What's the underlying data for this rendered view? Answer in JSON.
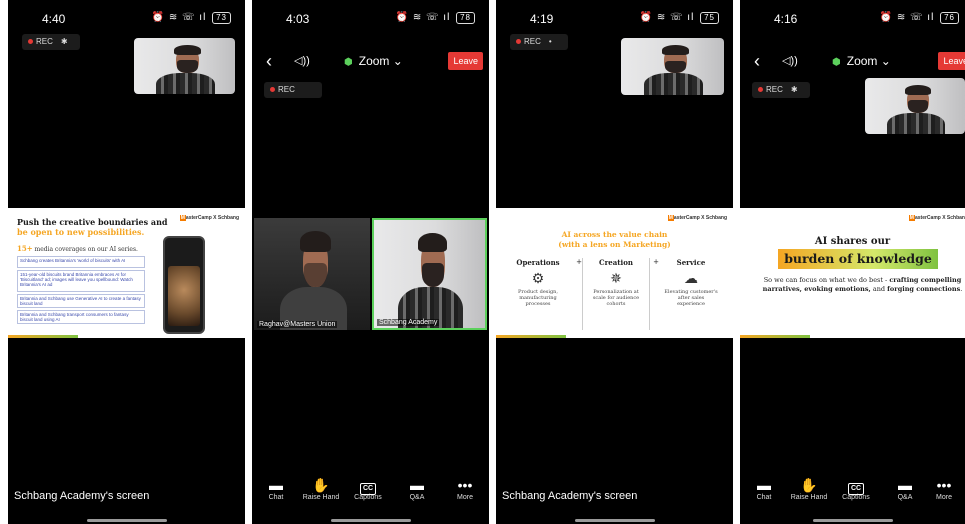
{
  "colors": {
    "leave": "#e53935",
    "rec_dot": "#e53935",
    "zoom_shield": "#5cd05c",
    "accent_orange": "#f5a623",
    "accent_green": "#7fc241"
  },
  "phones": [
    {
      "status": {
        "time": "4:40",
        "battery": "73"
      },
      "rec": {
        "label": "REC",
        "extra": "✱"
      },
      "screen_label": "Schbang Academy's screen",
      "slide": {
        "title1": "Push the creative boundaries and",
        "title2": "be open to new possibilities.",
        "coverage_count": "15+",
        "coverage_text": "media coverages on our AI series.",
        "items": [
          "Schbang creates Britannia's 'world of biscuits' with AI",
          "151-year-old biscuits brand Britannia embraces AI for 'Biscuitland' ad; images will leave you spellbound: Watch Britannia's AI ad",
          "Britannia and Schbang use Generative AI to create a fantasy biscuit land",
          "Britannia and Schbang transport consumers to fantasy biscuit land using AI"
        ],
        "mc": "asterCamp X Schbang",
        "mc_m": "M"
      }
    },
    {
      "status": {
        "time": "4:03",
        "battery": "78"
      },
      "rec": {
        "label": "REC",
        "extra": ""
      },
      "nav": {
        "back": "‹",
        "speaker": "◁))",
        "zoom": "Zoom ⌄",
        "leave": "Leave"
      },
      "tiles": [
        "Raghav@Masters Union",
        "Schbang Academy"
      ],
      "toolbar": [
        {
          "icon": "▬",
          "label": "Chat"
        },
        {
          "icon": "✋",
          "label": "Raise Hand"
        },
        {
          "icon": "CC",
          "label": "Captions"
        },
        {
          "icon": "▬",
          "label": "Q&A"
        },
        {
          "icon": "•••",
          "label": "More"
        }
      ]
    },
    {
      "status": {
        "time": "4:19",
        "battery": "75"
      },
      "rec": {
        "label": "REC",
        "extra": "•"
      },
      "screen_label": "Schbang Academy's screen",
      "slide": {
        "title1": "AI across the value chain",
        "title2": "(with a lens on Marketing)",
        "cols": [
          {
            "h": "Operations",
            "plus": "+",
            "t": "Product design, manufacturing processes"
          },
          {
            "h": "Creation",
            "plus": "+",
            "t": "Personalization at scale for audience cohorts"
          },
          {
            "h": "Service",
            "plus": "",
            "t": "Elevating customer's after sales experience"
          }
        ],
        "mc": "asterCamp X Schbang",
        "mc_m": "M"
      }
    },
    {
      "status": {
        "time": "4:16",
        "battery": "76"
      },
      "rec": {
        "label": "REC",
        "extra": "✱"
      },
      "nav": {
        "back": "‹",
        "speaker": "◁))",
        "zoom": "Zoom ⌄",
        "leave": "Leave"
      },
      "slide": {
        "title1": "AI shares our",
        "title2": "burden of knowledge",
        "body_a": "So we can focus on what we do best - ",
        "body_b": "crafting compelling narratives, evoking emotions,",
        "body_c": " and ",
        "body_d": "forging connections",
        "body_e": ".",
        "mc": "asterCamp X Schban",
        "mc_m": "M"
      },
      "toolbar": [
        {
          "icon": "▬",
          "label": "Chat"
        },
        {
          "icon": "✋",
          "label": "Raise Hand"
        },
        {
          "icon": "CC",
          "label": "Captions"
        },
        {
          "icon": "▬",
          "label": "Q&A"
        },
        {
          "icon": "•••",
          "label": "More"
        }
      ]
    }
  ]
}
